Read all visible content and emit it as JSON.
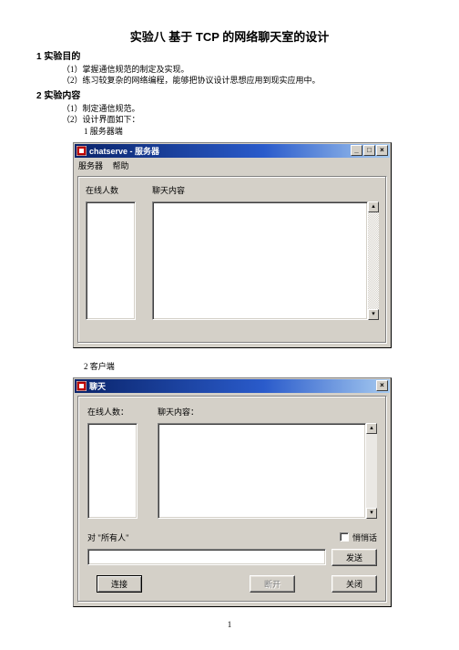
{
  "doc": {
    "title": "实验八  基于 TCP 的网络聊天室的设计",
    "sec1": "1  实验目的",
    "sec1_items": [
      "（1）掌握通信规范的制定及实现。",
      "（2）练习较复杂的网络编程，能够把协议设计思想应用到现实应用中。"
    ],
    "sec2": "2  实验内容",
    "sec2_items": [
      "（1）制定通信规范。",
      "（2）设计界面如下："
    ],
    "sub1": "1  服务器端",
    "sub2": "2  客户端",
    "pagenum": "1"
  },
  "win1": {
    "title": "chatserve - 服务器",
    "menu": {
      "m1": "服务器",
      "m2": "帮助"
    },
    "labels": {
      "online": "在线人数",
      "content": "聊天内容"
    },
    "tb": {
      "min": "_",
      "max": "□",
      "close": "×"
    }
  },
  "win2": {
    "title": "聊天",
    "labels": {
      "online": "在线人数：",
      "content": "聊天内容：",
      "to_prefix": "对  \"",
      "to_target": "所有人",
      "to_suffix": "\"",
      "whisper": "悄悄话"
    },
    "buttons": {
      "send": "发送",
      "connect": "连接",
      "logout": "断开",
      "close": "关闭"
    },
    "tb": {
      "close": "×"
    }
  }
}
